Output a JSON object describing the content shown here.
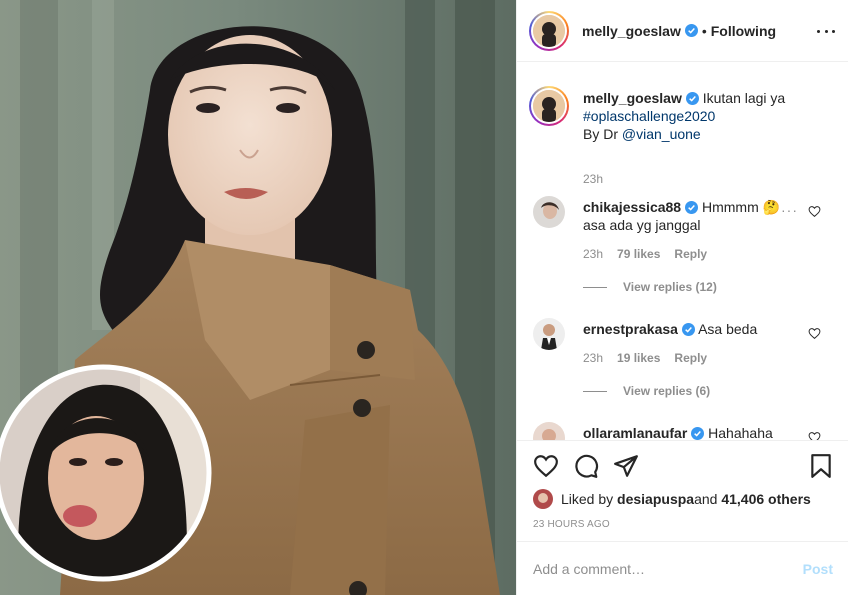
{
  "post": {
    "author": "melly_goeslaw",
    "separator": "•",
    "follow_status": "Following"
  },
  "caption": {
    "username": "melly_goeslaw",
    "line1": "Ikutan lagi ya",
    "hashtag": "#oplaschallenge2020",
    "line3_prefix": "By Dr ",
    "mention": "@vian_uone",
    "time": "23h"
  },
  "comments": [
    {
      "username": "chikajessica88",
      "text": "Hmmmm 🤔",
      "text2": "asa ada yg janggal",
      "time": "23h",
      "likes": "79 likes",
      "reply": "Reply",
      "view_replies": "View replies (12)"
    },
    {
      "username": "ernestprakasa",
      "text": "Asa beda",
      "time": "23h",
      "likes": "19 likes",
      "reply": "Reply",
      "view_replies": "View replies (6)"
    },
    {
      "username": "ollaramlanaufar",
      "text": "Hahahaha🔥"
    }
  ],
  "likes": {
    "prefix": "Liked by ",
    "user": "desiapuspa",
    "middle": " and ",
    "count": "41,406 others"
  },
  "time_ago": "23 HOURS AGO",
  "comment_box": {
    "placeholder": "Add a comment…",
    "post_label": "Post"
  },
  "colors": {
    "verified": "#3897f0",
    "link": "#00376b",
    "muted": "#8e8e8e",
    "post_disabled": "#b2dffc"
  },
  "icons": [
    "more-icon",
    "verified-icon",
    "heart-icon",
    "comment-icon",
    "share-icon",
    "bookmark-icon"
  ]
}
